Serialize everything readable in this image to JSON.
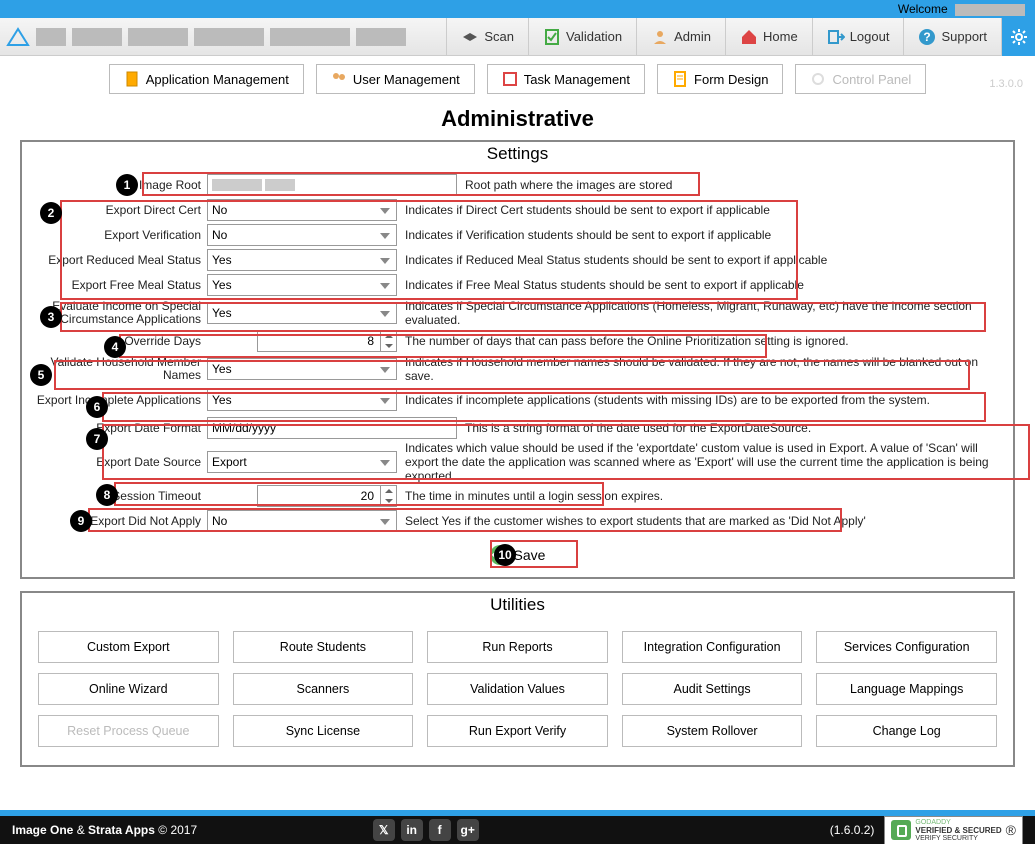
{
  "header": {
    "welcome": "Welcome"
  },
  "nav": {
    "scan": "Scan",
    "validation": "Validation",
    "admin": "Admin",
    "home": "Home",
    "logout": "Logout",
    "support": "Support"
  },
  "subnav": {
    "app_mgmt": "Application Management",
    "user_mgmt": "User Management",
    "task_mgmt": "Task Management",
    "form_design": "Form Design",
    "control_panel": "Control Panel",
    "version": "1.3.0.0"
  },
  "page": {
    "title": "Administrative"
  },
  "settings": {
    "title": "Settings",
    "image_root": {
      "label": "Image Root",
      "value": "",
      "desc": "Root path where the images are stored"
    },
    "export_direct_cert": {
      "label": "Export Direct Cert",
      "value": "No",
      "desc": "Indicates if Direct Cert students should be sent to export if applicable"
    },
    "export_verification": {
      "label": "Export Verification",
      "value": "No",
      "desc": "Indicates if Verification students should be sent to export if applicable"
    },
    "export_reduced": {
      "label": "Export Reduced Meal Status",
      "value": "Yes",
      "desc": "Indicates if Reduced Meal Status students should be sent to export if applicable"
    },
    "export_free": {
      "label": "Export Free Meal Status",
      "value": "Yes",
      "desc": "Indicates if Free Meal Status students should be sent to export if applicable"
    },
    "eval_income": {
      "label": "Evaluate Income on Special Circumstance Applications",
      "value": "Yes",
      "desc": "Indicates if Special Circumstance Applications (Homeless, Migrant, Runaway, etc) have the income section evaluated."
    },
    "override_days": {
      "label": "Override Days",
      "value": "8",
      "desc": "The number of days that can pass before the Online Prioritization setting is ignored."
    },
    "validate_hh": {
      "label": "Validate Household Member Names",
      "value": "Yes",
      "desc": "Indicates if Household member names should be validated. If they are not, the names will be blanked out on save."
    },
    "export_incomplete": {
      "label": "Export Incomplete Applications",
      "value": "Yes",
      "desc": "Indicates if incomplete applications (students with missing IDs) are to be exported from the system."
    },
    "export_date_format": {
      "label": "Export Date Format",
      "value": "MM/dd/yyyy",
      "desc": "This is a string format of the date used for the ExportDateSource."
    },
    "export_date_source": {
      "label": "Export Date Source",
      "value": "Export",
      "desc": "Indicates which value should be used if the 'exportdate' custom value is used in Export. A value of 'Scan' will export the date the application was scanned where as 'Export' will use the current time the application is being exported."
    },
    "session_timeout": {
      "label": "Session Timeout",
      "value": "20",
      "desc": "The time in minutes until a login session expires."
    },
    "export_did_not_apply": {
      "label": "Export Did Not Apply",
      "value": "No",
      "desc": "Select Yes if the customer wishes to export students that are marked as 'Did Not Apply'"
    },
    "save": "Save"
  },
  "utilities": {
    "title": "Utilities",
    "buttons": [
      "Custom Export",
      "Route Students",
      "Run Reports",
      "Integration Configuration",
      "Services Configuration",
      "Online Wizard",
      "Scanners",
      "Validation Values",
      "Audit Settings",
      "Language Mappings",
      "Reset Process Queue",
      "Sync License",
      "Run Export Verify",
      "System Rollover",
      "Change Log"
    ]
  },
  "footer": {
    "brand": "Image One & Strata Apps © 2017",
    "version": "(1.6.0.2)",
    "seal_top": "GODADDY",
    "seal_main": "VERIFIED & SECURED",
    "seal_sub": "VERIFY SECURITY"
  }
}
